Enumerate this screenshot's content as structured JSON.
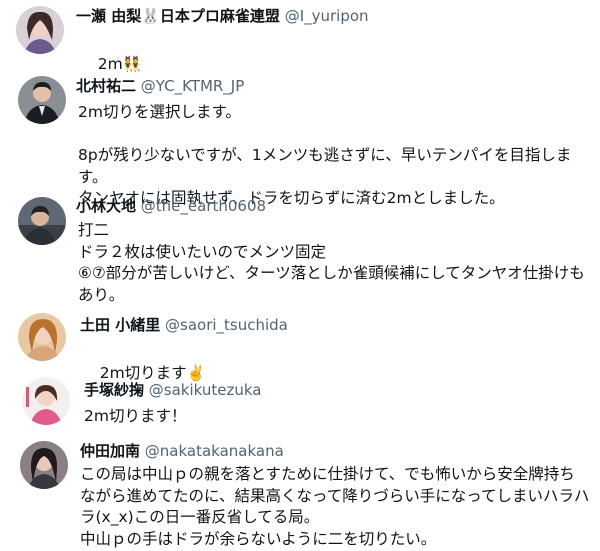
{
  "posts": [
    {
      "name": "一瀬 由梨🐰日本プロ麻雀連盟",
      "handle": "@I_yuripon",
      "text": "2m",
      "emoji": "👯",
      "avatar_icon": "avatar-woman-icon"
    },
    {
      "name": "北村祐二",
      "handle": "@YC_KTMR_JP",
      "text": "2m切りを選択します。\n\n8pが残り少ないですが、1メンツも逃さずに、早いテンパイを目指します。\nタンヤオには固執せず、ドラを切らずに済む2mとしました。",
      "avatar_icon": "avatar-man-suit-icon"
    },
    {
      "name": "小林大地",
      "handle": "@the_earth0608",
      "text": "打二\nドラ２枚は使いたいのでメンツ固定\n⑥⑦部分が苦しいけど、ターツ落としか雀頭候補にしてタンヤオ仕掛けもあり。",
      "avatar_icon": "avatar-man-icon"
    },
    {
      "name": "土田 小緒里",
      "handle": "@saori_tsuchida",
      "text": "2m切ります",
      "emoji": "✌️",
      "avatar_icon": "avatar-woman-smiling-icon"
    },
    {
      "name": "手塚紗掬",
      "handle": "@sakikutezuka",
      "text": "2m切ります！",
      "avatar_icon": "avatar-woman-pink-icon"
    },
    {
      "name": "仲田加南",
      "handle": "@nakatakanakana",
      "text": "この局は中山ｐの親を落とすために仕掛けて、でも怖いから安全牌持ちながら進めてたのに、結果高くなって降りづらい手になってしまいハラハラ(x_x)この日一番反省してる局。\n中山ｐの手はドラが余らないように二を切りたい。",
      "avatar_icon": "avatar-woman-dark-icon"
    }
  ]
}
